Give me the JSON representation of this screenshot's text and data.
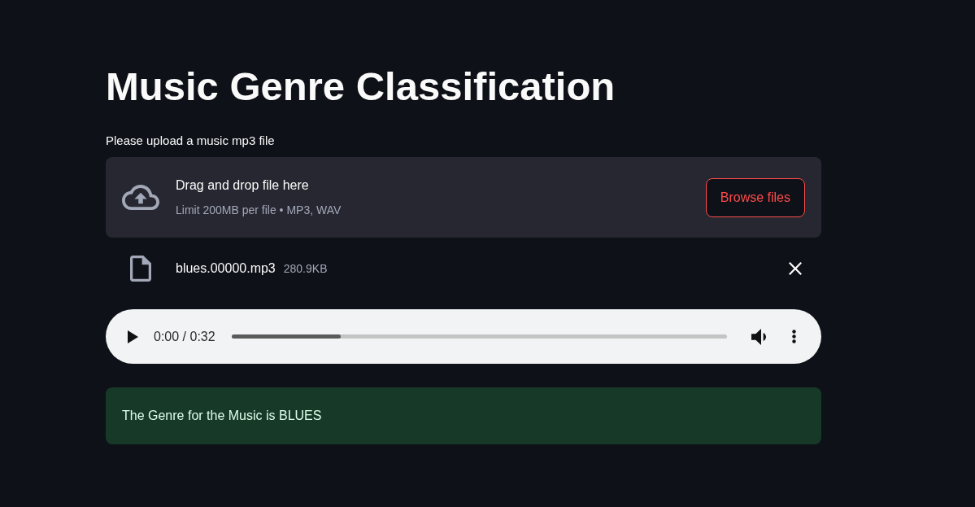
{
  "page": {
    "title": "Music Genre Classification"
  },
  "uploader": {
    "label": "Please upload a music mp3 file",
    "dropzone": {
      "instruction": "Drag and drop file here",
      "limits": "Limit 200MB per file • MP3, WAV",
      "button": "Browse files"
    },
    "files": [
      {
        "name": "blues.00000.mp3",
        "size": "280.9KB"
      }
    ]
  },
  "audio_player": {
    "playing": false,
    "time": "0:00 / 0:32",
    "level": 0.22
  },
  "result": {
    "kind": "success",
    "text": "The Genre for the Music is BLUES"
  }
}
